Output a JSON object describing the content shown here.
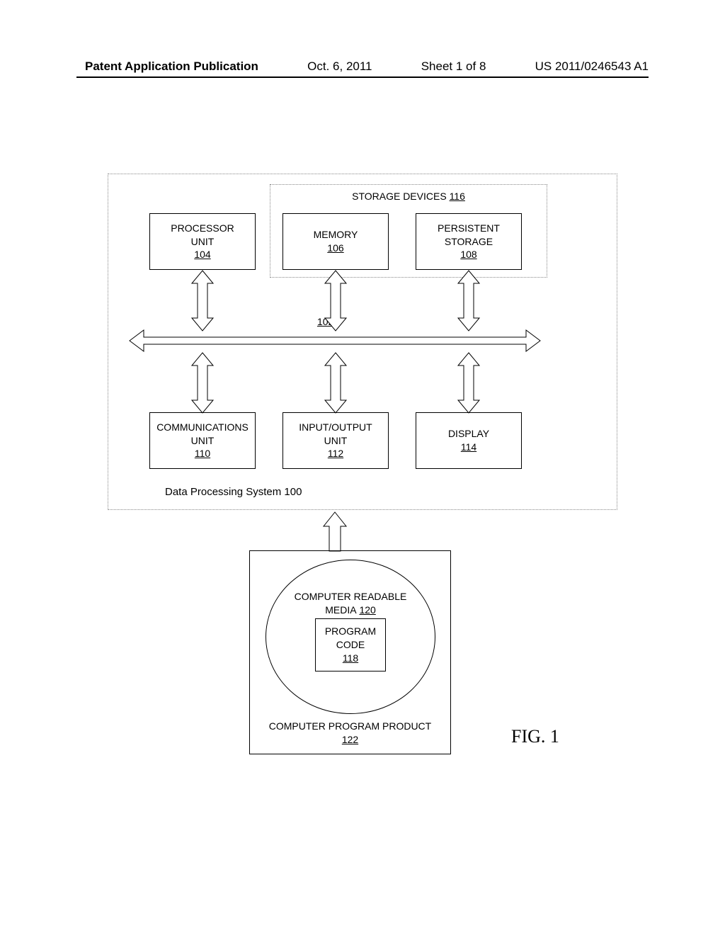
{
  "header": {
    "publication_type": "Patent Application Publication",
    "date": "Oct. 6, 2011",
    "sheet": "Sheet 1 of 8",
    "pub_number": "US 2011/0246543 A1"
  },
  "system": {
    "storage_label_text": "STORAGE DEVICES",
    "storage_label_ref": "116",
    "processor_l1": "PROCESSOR",
    "processor_l2": "UNIT",
    "processor_ref": "104",
    "memory_l1": "MEMORY",
    "memory_ref": "106",
    "persistent_l1": "PERSISTENT",
    "persistent_l2": "STORAGE",
    "persistent_ref": "108",
    "bus_ref": "102",
    "comm_l1": "COMMUNICATIONS",
    "comm_l2": "UNIT",
    "comm_ref": "110",
    "io_l1": "INPUT/OUTPUT",
    "io_l2": "UNIT",
    "io_ref": "112",
    "display_l1": "DISPLAY",
    "display_ref": "114",
    "sys_label": "Data Processing System 100"
  },
  "product": {
    "media_l1": "COMPUTER READABLE",
    "media_l2": "MEDIA",
    "media_ref": "120",
    "code_l1": "PROGRAM",
    "code_l2": "CODE",
    "code_ref": "118",
    "prod_l1": "COMPUTER PROGRAM PRODUCT",
    "prod_ref": "122"
  },
  "figure_label": "FIG. 1"
}
